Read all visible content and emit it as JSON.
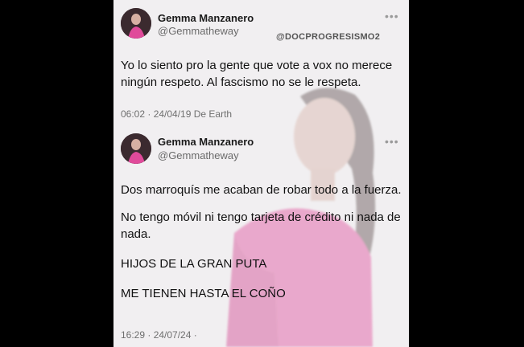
{
  "watermark": "@DOCPROGRESISMO2",
  "tweets": [
    {
      "author_name": "Gemma Manzanero",
      "author_handle": "@Gemmatheway",
      "more_icon": "more-icon",
      "text_lines": [
        "Yo lo siento pro la gente que vote a vox no merece",
        "ningún respeto. Al fascismo no se le respeta."
      ],
      "timestamp": "06:02 · 24/04/19 De Earth"
    },
    {
      "author_name": "Gemma Manzanero",
      "author_handle": "@Gemmatheway",
      "more_icon": "more-icon",
      "paragraphs": [
        "Dos marroquís me acaban de robar todo a la fuerza.",
        "No tengo móvil ni tengo tarjeta de crédito ni nada de",
        "nada.",
        "HIJOS DE LA GRAN PUTA",
        "ME TIENEN HASTA EL COÑO"
      ],
      "timestamp": "16:29 · 24/07/24 ·"
    }
  ],
  "colors": {
    "background": "#000000",
    "card": "#f1eff1",
    "dress": "#e04a9a"
  }
}
